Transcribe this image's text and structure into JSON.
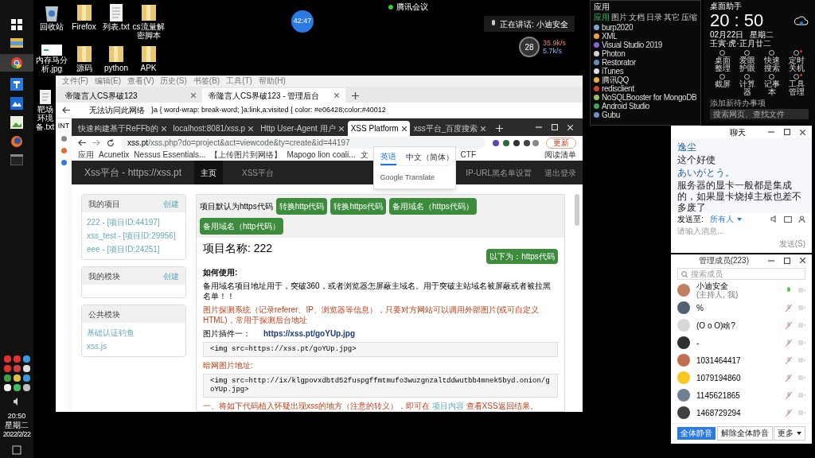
{
  "taskbar": {
    "time": "20:50",
    "weekday": "星期二",
    "date": "2022/2/22"
  },
  "desktop_icons": [
    {
      "label": "回收站",
      "kind": "bin"
    },
    {
      "label": "Firefox",
      "kind": "folder"
    },
    {
      "label": "列表.txt",
      "kind": "doc"
    },
    {
      "label": "cs流量解密脚本",
      "kind": "folder"
    },
    {
      "label": "内存马分析.jpg",
      "kind": "image"
    },
    {
      "label": "源码",
      "kind": "folder"
    },
    {
      "label": "python",
      "kind": "folder"
    },
    {
      "label": "APK",
      "kind": "folder"
    },
    {
      "label": "靶场环境备.txt",
      "kind": "doc"
    }
  ],
  "meeting": {
    "name": "腾讯会议",
    "timer": "42:47",
    "speaking": "正在讲话: 小迪安全"
  },
  "net_widget": {
    "value": "28",
    "up": "35.9k/s",
    "down": "5.7k/s"
  },
  "outer_browser": {
    "menu": [
      "文件(F)",
      "编辑(E)",
      "查看(V)",
      "历史(S)",
      "书签(B)",
      "工具(T)",
      "帮助(H)"
    ],
    "tabs": [
      {
        "title": "帝隆言人CS界破123",
        "selected": false
      },
      {
        "title": "帝隆言人CS界破123 - 管理后台",
        "selected": true
      }
    ],
    "error": "无法访问此网络",
    "address": "}a { word-wrap: break-word; }a:link,a:visited { color: #e06428;color:#40012",
    "page_text": "INT"
  },
  "chrome": {
    "tabs": [
      {
        "title": "快速构建基于ReFFb的",
        "selected": false
      },
      {
        "title": "localhost:8081/xss.p",
        "selected": false
      },
      {
        "title": "Http User-Agent 用户",
        "selected": false
      },
      {
        "title": "XSS Platform",
        "selected": true
      },
      {
        "title": "xss平台_百度搜索",
        "selected": false
      }
    ],
    "url_host": "xss.pt",
    "url_path": "/xss.php?do=project&act=viewcode&ty=create&id=44197",
    "update_button": "更新",
    "bookmarks": [
      "应用",
      "Acunetix",
      "Nessus Essentials...",
      "【上传图片到网络】",
      "Mapogo lion coali...",
      "文"
    ],
    "bookmarks_right": [
      "CTF"
    ],
    "reading_list": "阅读清单"
  },
  "translate": {
    "tabs": [
      {
        "label": "英语",
        "selected": true
      },
      {
        "label": "中文（简体）",
        "selected": false
      }
    ],
    "footer": "Google Translate"
  },
  "site": {
    "brand": "Xss平台 - https://xss.pt",
    "nav": [
      {
        "label": "主页",
        "selected": true
      },
      {
        "label": "XSS平台",
        "selected": false
      }
    ],
    "nav_right": [
      "IP-URL黑名单设置",
      "退出登录"
    ],
    "panels": [
      {
        "title": "我的项目",
        "action": "创建",
        "items": [
          "222 - [项目ID:44197]",
          "xss_test - [项目ID:29956]",
          "eee - [项目ID:24251]"
        ]
      },
      {
        "title": "我的模块",
        "action": "创建"
      },
      {
        "title": "公共模块",
        "items": [
          "基础认证钓鱼",
          "xss.js"
        ]
      }
    ],
    "toolbar_label": "项目默认为https代码",
    "toolbar_buttons": [
      "转换http代码",
      "转换https代码",
      "备用域名（https代码）",
      "备用域名（http代码）"
    ],
    "project_title": "项目名称: 222",
    "code_button": "以下为：https代码",
    "how_to": "如何使用:",
    "note": "备用域名项目地址用于，突破360，或者浏览器怎屏蔽主域名。用于突破主站域名被屏蔽或者被拉黑名单！！",
    "image_probe": "图片探测系统（记录referer、IP、浏览器等信息），只要对方网站可以调用外部图片(或可自定义HTML)，常用于探测后台地址",
    "plugin_label": "图片插件一：",
    "plugin_link": "https://xss.pt/goYUp.jpg",
    "code_1": "<img src=https://xss.pt/goYUp.jpg>",
    "darknet_label": "暗网图片地址:",
    "code_2": "<img src=http://ix/klgpovxdbtd52fuspgffmtmufo3wuzgnzaltddwutbb4mnek5byd.onion/goYUp.jpg>",
    "last_line": "一、将如下代码植入怀疑出现xss的地方（注意的转义），即可在 ",
    "last_link": "项目内容",
    "last_tail": " 查看XSS返回结果。"
  },
  "app_panel": {
    "title": "应用",
    "tabs": [
      {
        "label": "应用",
        "selected": true
      },
      {
        "label": "图片",
        "selected": false
      },
      {
        "label": "文档",
        "selected": false
      },
      {
        "label": "日录",
        "selected": false
      },
      {
        "label": "其它",
        "selected": false
      },
      {
        "label": "压缩",
        "selected": false
      }
    ],
    "items": [
      {
        "label": "burp2020",
        "color": "#7aa7d8"
      },
      {
        "label": "XML",
        "color": "#f0a040"
      },
      {
        "label": "Visual Studio 2019",
        "color": "#8a5fd0"
      },
      {
        "label": "Photon",
        "color": "#d0d0d0"
      },
      {
        "label": "Restorator",
        "color": "#6090c0"
      },
      {
        "label": "iTunes",
        "color": "#e0e0f0"
      },
      {
        "label": "腾讯QQ",
        "color": "#e8b040"
      },
      {
        "label": "redisclient",
        "color": "#d04030"
      },
      {
        "label": "NoSQLBooster for MongoDB",
        "color": "#a0c060"
      },
      {
        "label": "Android Studio",
        "color": "#40a060"
      },
      {
        "label": "Gubu",
        "color": "#7090d0"
      }
    ]
  },
  "clock_panel": {
    "title": "桌面助手",
    "time": "20 : 50",
    "date": "02月22日",
    "weekday": "星期二",
    "lunar": "壬寅·虎·正月廿二",
    "tools": [
      {
        "label": "桌面整理",
        "badge": false
      },
      {
        "label": "爱眼护眼",
        "badge": false
      },
      {
        "label": "快速搜索",
        "badge": false
      },
      {
        "label": "定时关机",
        "badge": true
      },
      {
        "label": "截屏",
        "badge": false
      },
      {
        "label": "计算器",
        "badge": false
      },
      {
        "label": "记事本",
        "badge": false
      },
      {
        "label": "工具管理",
        "badge": true
      }
    ],
    "todo": "添加新待办事项",
    "search_placeholder": "搜索网页、查找文件"
  },
  "chat": {
    "title": "聊天",
    "messages": [
      {
        "text": "逸尘",
        "kind": "sender"
      },
      {
        "text": "这个好使",
        "kind": "text"
      },
      {
        "text": "あいがとう。",
        "kind": "sender"
      },
      {
        "text": "服务器的显卡一般都是集成的，如果显卡烧掉主板也差不多废了",
        "kind": "text"
      }
    ],
    "send_to_label": "发送至:",
    "send_to": "所有人",
    "placeholder": "请输入消息...",
    "send": "发送(S)"
  },
  "members": {
    "title": "管理成员(223)",
    "search_placeholder": "搜索成员",
    "list": [
      {
        "name": "小迪安全",
        "role": "(主持人, 我)",
        "muted": false,
        "color": "#c08060"
      },
      {
        "name": "%",
        "muted": true,
        "color": "#506070"
      },
      {
        "name": "(O o O)啥?",
        "muted": true,
        "color": "#d8d8d8"
      },
      {
        "name": "-",
        "muted": true,
        "color": "#303030"
      },
      {
        "name": "1031464417",
        "muted": true,
        "color": "#c07050"
      },
      {
        "name": "1079194860",
        "muted": true,
        "color": "#f8c820"
      },
      {
        "name": "1145621865",
        "muted": true,
        "color": "#708090"
      },
      {
        "name": "1468729294",
        "muted": true,
        "color": "#404040"
      }
    ],
    "buttons": [
      {
        "label": "全体静音",
        "kind": "primary"
      },
      {
        "label": "解除全体静音",
        "kind": "secondary"
      },
      {
        "label": "更多",
        "kind": "menu"
      }
    ]
  }
}
